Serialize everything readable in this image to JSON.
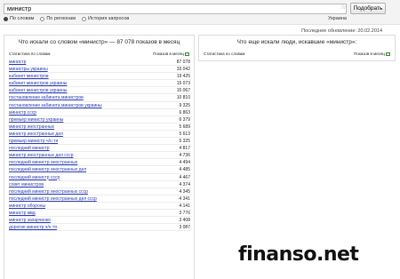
{
  "search": {
    "value": "министр",
    "button_label": "Подобрать"
  },
  "tabs": [
    {
      "label": "По словам",
      "selected": true
    },
    {
      "label": "По регионам",
      "selected": false
    },
    {
      "label": "История запросов",
      "selected": false
    }
  ],
  "region": "Украина",
  "updated": "Последнее обновление: 20.02.2014",
  "left_panel": {
    "title": "Что искали со словом «министр» — 87 078 показов в месяц",
    "col_keywords": "Статистика по словам",
    "col_shows": "Показов в месяц",
    "rows": [
      {
        "keyword": "министр",
        "shows": "87 078"
      },
      {
        "keyword": "министры украины",
        "shows": "33 042"
      },
      {
        "keyword": "кабинет министров",
        "shows": "19 425"
      },
      {
        "keyword": "кабинет министров украины",
        "shows": "15 073"
      },
      {
        "keyword": "кабинет министров украины",
        "shows": "15 067"
      },
      {
        "keyword": "постановление кабинета министров",
        "shows": "10 810"
      },
      {
        "keyword": "постановление кабинета министров украины",
        "shows": "9 325"
      },
      {
        "keyword": "министр ссср",
        "shows": "6 863"
      },
      {
        "keyword": "премьер министр украины",
        "shows": "6 379"
      },
      {
        "keyword": "министр иностранных",
        "shows": "5 689"
      },
      {
        "keyword": "министр иностранных дел",
        "shows": "5 613"
      },
      {
        "keyword": "премьер министр ч/н тя",
        "shows": "5 325"
      },
      {
        "keyword": "последний министр",
        "shows": "4 817"
      },
      {
        "keyword": "министр иностранных дел ссср",
        "shows": "4 736"
      },
      {
        "keyword": "последний министр иностранных",
        "shows": "4 494"
      },
      {
        "keyword": "последний министр иностранных дел",
        "shows": "4 485"
      },
      {
        "keyword": "последний министр ссср",
        "shows": "4 467"
      },
      {
        "keyword": "совет министров",
        "shows": "4 374"
      },
      {
        "keyword": "последний министр иностранных ссср",
        "shows": "4 345"
      },
      {
        "keyword": "последний министр иностранных дел ссср",
        "shows": "4 341"
      },
      {
        "keyword": "министр обороны",
        "shows": "4 141"
      },
      {
        "keyword": "министр мвд",
        "shows": "3 776"
      },
      {
        "keyword": "министр захарченко",
        "shows": "3 408"
      },
      {
        "keyword": "дорогие министр ч/н тя",
        "shows": "3 087"
      }
    ]
  },
  "right_panel": {
    "title": "Что еще искали люди, искавшие «министр»:",
    "col_keywords": "Статистика по словам",
    "col_shows": "Показов в месяц"
  },
  "watermark": "finanso.net"
}
